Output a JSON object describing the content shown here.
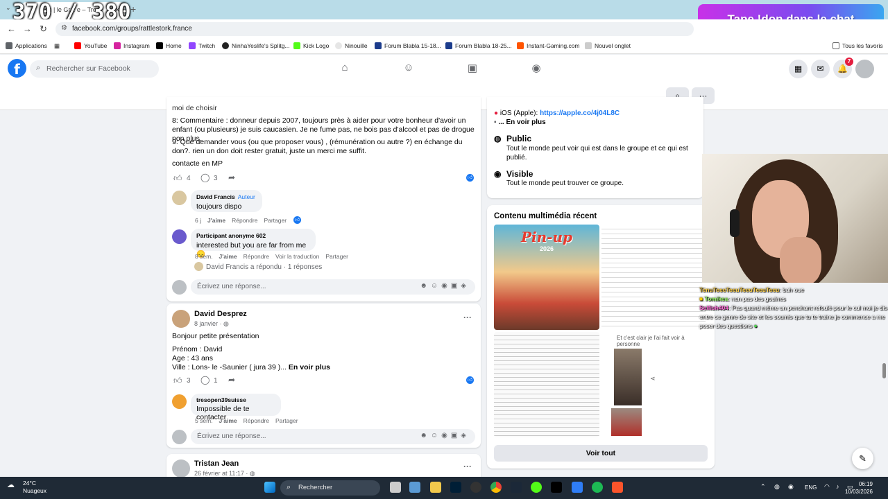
{
  "browser": {
    "tab_title": "Don | le Gr... e – Tro...",
    "url": "facebook.com/groups/rattlestork.france",
    "bookmarks": [
      "Applications",
      "YouTube",
      "Instagram",
      "Home",
      "Twitch",
      "NinhaYeslife's Splitg...",
      "Kick Logo",
      "Ninouille",
      "Forum Blabla 15-18...",
      "Forum Blabla 18-25...",
      "Instant-Gaming.com",
      "Nouvel onglet"
    ],
    "all_bookmarks": "Tous les favoris"
  },
  "overlay": {
    "counter": "370 / 380",
    "don_banner": "Tape !don dans le chat"
  },
  "fb": {
    "search_placeholder": "Rechercher sur Facebook",
    "notif_count": "7"
  },
  "post1": {
    "partial_line": "moi de choisir",
    "q8": "8: Commentaire : donneur depuis 2007, toujours près à aider pour votre bonheur d'avoir un enfant (ou plusieurs) je suis caucasien. Je ne fume pas, ne bois pas d'alcool et pas de drogue non plus.",
    "q9": "9: Que demander vous (ou que proposer vous) , (rémunération ou autre ?) en échange du don?. rien un don doit rester gratuit, juste un merci me suffit.",
    "contact": "contacte en MP",
    "likes": "4",
    "comments": "3",
    "c1": {
      "author": "David Francis",
      "badge": "Auteur",
      "text": "toujours dispo",
      "time": "6 j",
      "like": "J'aime",
      "reply": "Répondre",
      "share": "Partager"
    },
    "c2": {
      "author": "Participant anonyme 602",
      "text": "interested but you are far from me",
      "emoji": "😞",
      "time": "8 sem.",
      "like": "J'aime",
      "reply": "Répondre",
      "translate": "Voir la traduction",
      "share": "Partager"
    },
    "replied": "David Francis a répondu · 1 réponses",
    "reply_placeholder": "Écrivez une réponse..."
  },
  "post2": {
    "author": "David Desprez",
    "date": "8 janvier ·",
    "intro": "Bonjour petite présentation",
    "line1": "Prénom : David",
    "line2": "Age : 43 ans",
    "line3": "Ville :  Lons- le -Saunier ( jura 39 )...",
    "see_more": "En voir plus",
    "likes": "3",
    "comments": "1",
    "c1": {
      "author": "tresopen39suisse",
      "text": "Impossible de te contacter",
      "time": "5 sem.",
      "like": "J'aime",
      "reply": "Répondre",
      "share": "Partager"
    },
    "reply_placeholder": "Écrivez une réponse..."
  },
  "post3": {
    "author": "Tristan Jean",
    "date": "26 février at 11:17 ·"
  },
  "about": {
    "ios": "iOS (Apple): ",
    "ios_link": "https://apple.co/4j04L8C",
    "see_more": "... En voir plus",
    "public_title": "Public",
    "public_desc": "Tout le monde peut voir qui est dans le groupe et ce qui est publié.",
    "visible_title": "Visible",
    "visible_desc": "Tout le monde peut trouver ce groupe."
  },
  "media": {
    "title": "Contenu multimédia récent",
    "poster_title": "Pin-up",
    "poster_year": "2026",
    "caption": "Et c'est clair je l'ai fait voir à personne",
    "see_all": "Voir tout"
  },
  "chat": [
    {
      "user": "TenuTeeeTeeuTeeuTeeuTeeu",
      "text": ": bah oue"
    },
    {
      "user": "Tomikea",
      "text": ": nan pas des goulnes"
    },
    {
      "user": "Selfish404",
      "text": ": Pas quand même un penchant refoulé pour le cul moi je dis entre ce genre de site et les soumis que tu te traine je commence a me poser des questions"
    }
  ],
  "taskbar": {
    "temp": "24°C",
    "weather": "Nuageux",
    "search": "Rechercher",
    "lang": "ENG",
    "time": "06:19",
    "date": "10/03/2026"
  }
}
